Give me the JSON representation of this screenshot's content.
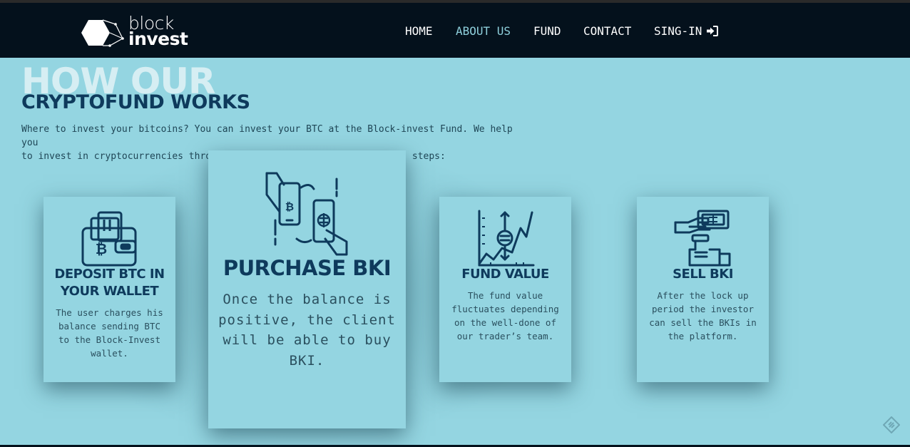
{
  "brand": {
    "line1": "block",
    "line2": "invest"
  },
  "nav": {
    "items": [
      {
        "label": "HOME"
      },
      {
        "label": "ABOUT US"
      },
      {
        "label": "FUND"
      },
      {
        "label": "CONTACT"
      },
      {
        "label": "SING-IN"
      }
    ]
  },
  "hero": {
    "ghost_heading": "HOW OUR",
    "heading": "CRYPTOFUND WORKS",
    "intro_line1": "Where to invest your bitcoins? You can invest your BTC at the Block-invest Fund. We help you",
    "intro_line2": "to invest in cryptocurrencies through our platform following the next steps:"
  },
  "steps": [
    {
      "title": "DEPOSIT BTC IN YOUR WALLET",
      "icon": "wallet-bitcoin-icon",
      "text": "The user charges his balance sending BTC to the Block-Invest wallet."
    },
    {
      "title": "PURCHASE BKI",
      "icon": "phone-exchange-icon",
      "text": "Once the balance is positive, the client will be able to buy BKI."
    },
    {
      "title": "FUND VALUE",
      "icon": "chart-growth-icon",
      "text": "The fund value fluctuates depending on the well-done of our trader’s team."
    },
    {
      "title": "SELL BKI",
      "icon": "sell-cash-icon",
      "text": "After the lock up period the investor can sell the BKIs in the platform."
    }
  ],
  "colors": {
    "background": "#94d5e1",
    "navbar": "#04111c",
    "accent": "#8fd0dc",
    "heading": "#0e3a5c",
    "text": "#2a4f5e"
  }
}
